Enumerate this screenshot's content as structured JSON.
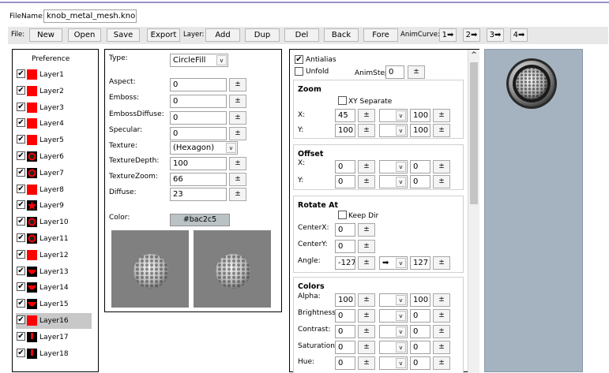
{
  "filename": {
    "label": "FileName:",
    "value": "knob_metal_mesh.knob"
  },
  "toolbar": {
    "file_label": "File:",
    "new": "New",
    "open": "Open",
    "save": "Save",
    "export": "Export",
    "layer_label": "Layer:",
    "add": "Add",
    "dup": "Dup",
    "del": "Del",
    "back": "Back",
    "fore": "Fore",
    "animcurve_label": "AnimCurve:",
    "curve1": "1➡",
    "curve2": "2➡",
    "curve3": "3➡",
    "curve4": "4➡"
  },
  "layers": {
    "header": "Preference",
    "items": [
      {
        "label": "Layer1",
        "checked": "✔",
        "thumb": "square"
      },
      {
        "label": "Layer2",
        "checked": "✔",
        "thumb": "square"
      },
      {
        "label": "Layer3",
        "checked": "✔",
        "thumb": "square"
      },
      {
        "label": "Layer4",
        "checked": "✔",
        "thumb": "square"
      },
      {
        "label": "Layer5",
        "checked": "✔",
        "thumb": "square"
      },
      {
        "label": "Layer6",
        "checked": "✔",
        "thumb": "circle"
      },
      {
        "label": "Layer7",
        "checked": "✔",
        "thumb": "circle"
      },
      {
        "label": "Layer8",
        "checked": "✔",
        "thumb": "square"
      },
      {
        "label": "Layer9",
        "checked": "✔",
        "thumb": "star"
      },
      {
        "label": "Layer10",
        "checked": "✔",
        "thumb": "circle"
      },
      {
        "label": "Layer11",
        "checked": "✔",
        "thumb": "circle"
      },
      {
        "label": "Layer12",
        "checked": "✔",
        "thumb": "square"
      },
      {
        "label": "Layer13",
        "checked": "✔",
        "thumb": "bowl"
      },
      {
        "label": "Layer14",
        "checked": "✔",
        "thumb": "bowl"
      },
      {
        "label": "Layer15",
        "checked": "✔",
        "thumb": "bowl"
      },
      {
        "label": "Layer16",
        "checked": "✔",
        "thumb": "square"
      },
      {
        "label": "Layer17",
        "checked": "✔",
        "thumb": "bar"
      },
      {
        "label": "Layer18",
        "checked": "✔",
        "thumb": "bar"
      }
    ],
    "selected_index": 15
  },
  "props": {
    "type_label": "Type:",
    "type_value": "CircleFill",
    "aspect_label": "Aspect:",
    "aspect": "0",
    "emboss_label": "Emboss:",
    "emboss": "0",
    "embossdiffuse_label": "EmbossDiffuse:",
    "embossdiffuse": "0",
    "specular_label": "Specular:",
    "specular": "0",
    "texture_label": "Texture:",
    "texture_value": "(Hexagon)",
    "texturedepth_label": "TextureDepth:",
    "texturedepth": "100",
    "texturezoom_label": "TextureZoom:",
    "texturezoom": "66",
    "diffuse_label": "Diffuse:",
    "diffuse": "23",
    "color_label": "Color:",
    "color_value": "#bac2c5",
    "pm": "±"
  },
  "anim": {
    "antialias_label": "Antialias",
    "antialias_checked": "✔",
    "unfold_label": "Unfold",
    "unfold_checked": "",
    "animstep_label": "AnimStep:",
    "animstep": "0",
    "zoom": {
      "title": "Zoom",
      "xy_separate": "XY Separate",
      "x_label": "X:",
      "x_from": "45",
      "x_to": "100",
      "y_label": "Y:",
      "y_from": "100",
      "y_to": "100"
    },
    "offset": {
      "title": "Offset",
      "x_label": "X:",
      "x_from": "0",
      "x_to": "0",
      "y_label": "Y:",
      "y_from": "0",
      "y_to": "0"
    },
    "rotate": {
      "title": "Rotate At",
      "keep_dir": "Keep Dir",
      "centerx_label": "CenterX:",
      "centerx": "0",
      "centery_label": "CenterY:",
      "centery": "0",
      "angle_label": "Angle:",
      "angle_from": "-127",
      "curve": "➡",
      "angle_to": "127"
    },
    "colors": {
      "title": "Colors",
      "alpha_label": "Alpha:",
      "alpha_from": "100",
      "alpha_to": "100",
      "brightness_label": "Brightness:",
      "brightness_from": "0",
      "brightness_to": "0",
      "contrast_label": "Contrast:",
      "contrast_from": "0",
      "contrast_to": "0",
      "saturation_label": "Saturation:",
      "saturation_from": "0",
      "saturation_to": "0",
      "hue_label": "Hue:",
      "hue_from": "0",
      "hue_to": "0"
    },
    "dropdown_arrow": "v",
    "scroll_up": "^"
  },
  "colors_theme": {
    "preview_bg": "#a5b3c0",
    "swatch_bg": "#bac2c5",
    "texture_bg": "#808080",
    "selected_row": "#c8c8c8",
    "layer_red": "#ff0000"
  }
}
